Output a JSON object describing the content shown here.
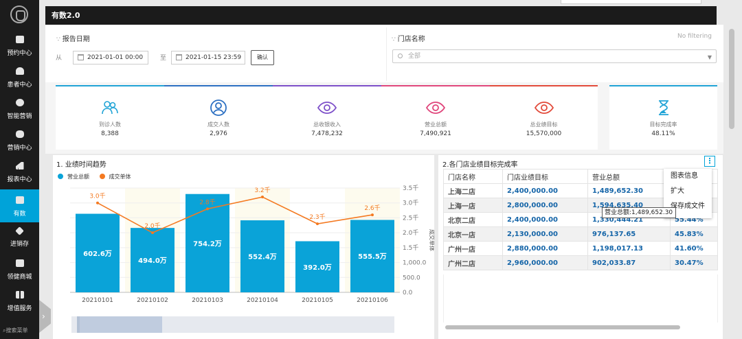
{
  "sidebar": {
    "items": [
      {
        "label": "预约中心",
        "icon": "calendar-icon"
      },
      {
        "label": "患者中心",
        "icon": "user-icon"
      },
      {
        "label": "智能营销",
        "icon": "target-icon"
      },
      {
        "label": "营销中心",
        "icon": "fan-icon"
      },
      {
        "label": "报表中心",
        "icon": "bar-chart-icon"
      },
      {
        "label": "有数",
        "icon": "trend-icon",
        "active": true
      },
      {
        "label": "进销存",
        "icon": "layers-icon"
      },
      {
        "label": "领健商城",
        "icon": "shop-icon"
      },
      {
        "label": "增值服务",
        "icon": "grid-icon"
      }
    ],
    "search_label": "搜索菜单"
  },
  "header": {
    "title": "有数2.0"
  },
  "filters": {
    "report_date_label": "报告日期",
    "from_label": "从",
    "from_value": "2021-01-01 00:00",
    "to_label": "至",
    "to_value": "2021-01-15 23:59",
    "confirm_label": "确认",
    "store_label": "门店名称",
    "no_filtering": "No filtering",
    "store_placeholder": "全部"
  },
  "kpis": [
    {
      "title": "到诊人数",
      "value": "8,388",
      "color": "#1fa3d6",
      "icon": "people-icon"
    },
    {
      "title": "成交人数",
      "value": "2,976",
      "color": "#2b6fc2",
      "icon": "person-circle-icon"
    },
    {
      "title": "总收银收入",
      "value": "7,478,232",
      "color": "#7d4fc9",
      "icon": "eye-icon"
    },
    {
      "title": "营业总额",
      "value": "7,490,921",
      "color": "#e0457b",
      "icon": "eye-icon"
    },
    {
      "title": "总业绩目标",
      "value": "15,570,000",
      "color": "#e24a3a",
      "icon": "eye-icon"
    },
    {
      "title": "目标完成率",
      "value": "48.11%",
      "color": "#1fa3d6",
      "icon": "hourglass-icon"
    }
  ],
  "trend": {
    "title": "1. 业绩时间趋势"
  },
  "chart_data": {
    "type": "bar",
    "categories": [
      "20210101",
      "20210102",
      "20210103",
      "20210104",
      "20210105",
      "20210106"
    ],
    "series": [
      {
        "name": "营业总额",
        "type": "bar",
        "color": "#0aa3d8",
        "values": [
          6026000,
          4940000,
          7542000,
          5524000,
          3920000,
          5555000
        ],
        "labels": [
          "602.6万",
          "494.0万",
          "754.2万",
          "552.4万",
          "392.0万",
          "555.5万"
        ]
      },
      {
        "name": "成交单体",
        "type": "line",
        "color": "#f47920",
        "values": [
          3000,
          2000,
          2800,
          3200,
          2300,
          2600
        ],
        "labels": [
          "3.0千",
          "2.0千",
          "2.8千",
          "3.2千",
          "2.3千",
          "2.6千"
        ]
      }
    ],
    "y2label": "成交单体",
    "y2ticks": [
      "0.0",
      "500.0",
      "1,000.0",
      "1.5千",
      "2.0千",
      "2.5千",
      "3.0千",
      "3.5千"
    ],
    "y2lim": [
      0,
      3500
    ],
    "ylim": [
      0,
      8000000
    ]
  },
  "table": {
    "title": "2.各门店业绩目标完成率",
    "columns": [
      "门店名称",
      "门店业绩目标",
      "营业总额",
      ""
    ],
    "rows": [
      [
        "上海二店",
        "2,400,000.00",
        "1,489,652.30",
        ""
      ],
      [
        "上海一店",
        "2,800,000.00",
        "1,594,635.40",
        ""
      ],
      [
        "北京二店",
        "2,400,000.00",
        "1,330,444.21",
        "55.44%"
      ],
      [
        "北京一店",
        "2,130,000.00",
        "976,137.65",
        "45.83%"
      ],
      [
        "广州一店",
        "2,880,000.00",
        "1,198,017.13",
        "41.60%"
      ],
      [
        "广州二店",
        "2,960,000.00",
        "902,033.87",
        "30.47%"
      ]
    ],
    "menu": [
      "图表信息",
      "扩大",
      "保存成文件"
    ],
    "tooltip": "营业总额:1,489,652.30"
  }
}
